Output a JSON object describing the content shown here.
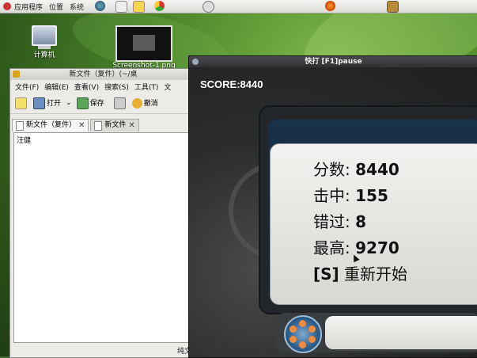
{
  "top_panel": {
    "menus": [
      "应用程序",
      "位置",
      "系统"
    ],
    "icons": [
      "globe-icon",
      "home-icon",
      "notes-icon",
      "chrome-icon",
      "power-icon",
      "firefox-icon",
      "package-icon"
    ]
  },
  "desktop": {
    "icons": [
      {
        "label": "计算机",
        "icon": "computer-icon"
      },
      {
        "label": "Screenshot-1.png",
        "icon": "image-icon"
      }
    ]
  },
  "editor": {
    "title": "新文件（复件）(~/桌",
    "menus": [
      "文件(F)",
      "编辑(E)",
      "查看(V)",
      "搜索(S)",
      "工具(T)",
      "文"
    ],
    "toolbar": {
      "open": "打开",
      "save": "保存",
      "undo": "撤消"
    },
    "tabs": [
      {
        "label": "新文件（复件）",
        "active": true
      },
      {
        "label": "新文件",
        "active": false
      }
    ],
    "content": "汪健",
    "status": "纯文"
  },
  "game": {
    "title": "快打  [F1]pause",
    "score_label": "SCORE:8440",
    "stats": {
      "score_label": "分数:",
      "score_value": "8440",
      "hits_label": "击中:",
      "hits_value": "155",
      "miss_label": "错过:",
      "miss_value": "8",
      "best_label": "最高:",
      "best_value": "9270",
      "restart_key": "[S]",
      "restart_label": " 重新开始"
    }
  }
}
